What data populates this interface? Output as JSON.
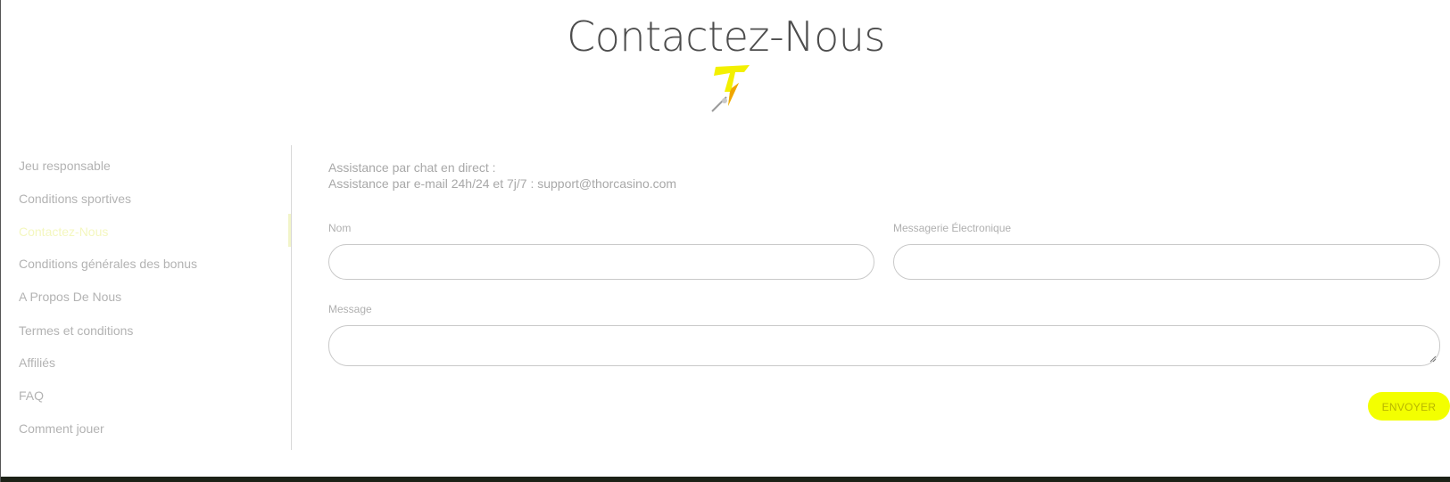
{
  "page": {
    "title": "Contactez-Nous",
    "logo_icon": "thor-lightning-logo-icon"
  },
  "sidebar": {
    "items": [
      {
        "label": "Jeu responsable",
        "active": false
      },
      {
        "label": "Conditions sportives",
        "active": false
      },
      {
        "label": "Contactez-Nous",
        "active": true
      },
      {
        "label": "Conditions générales des bonus",
        "active": false
      },
      {
        "label": "A Propos De Nous",
        "active": false
      },
      {
        "label": "Termes et conditions",
        "active": false
      },
      {
        "label": "Affiliés",
        "active": false
      },
      {
        "label": "FAQ",
        "active": false
      },
      {
        "label": "Comment jouer",
        "active": false
      }
    ]
  },
  "contact": {
    "chat_line": "Assistance par chat en direct :",
    "email_line": "Assistance par e-mail 24h/24 et 7j/7 : support@thorcasino.com"
  },
  "form": {
    "name_label": "Nom",
    "name_value": "",
    "email_label": "Messagerie Électronique",
    "email_value": "",
    "message_label": "Message",
    "message_value": "",
    "submit_label": "ENVOYER"
  },
  "colors": {
    "accent": "#f3ff00",
    "active_nav": "#f4f7bf",
    "footer": "#1c2217"
  }
}
